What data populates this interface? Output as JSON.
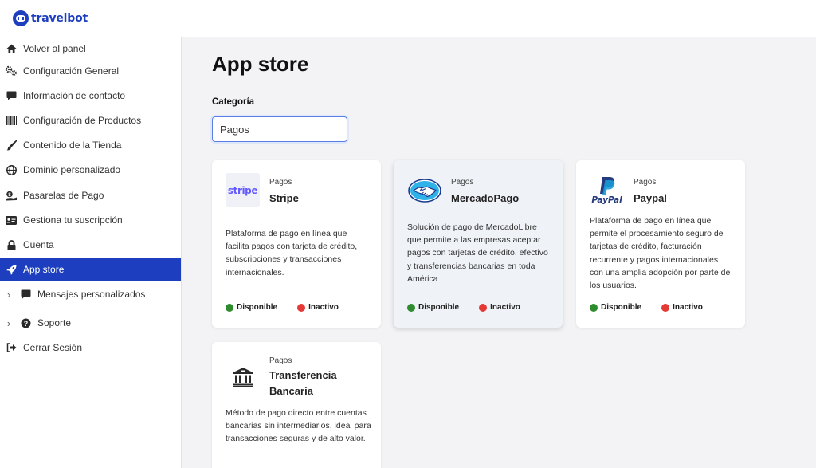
{
  "brand": {
    "name": "travelbot",
    "color": "#1d3fbf"
  },
  "sidebar": {
    "items": [
      {
        "label": "Volver al panel",
        "icon": "home-icon"
      },
      {
        "label": "Configuración General",
        "icon": "cogs-icon"
      },
      {
        "label": "Información de contacto",
        "icon": "comment-icon"
      },
      {
        "label": "Configuración de Productos",
        "icon": "barcode-icon"
      },
      {
        "label": "Contenido de la Tienda",
        "icon": "brush-icon"
      },
      {
        "label": "Dominio personalizado",
        "icon": "globe-icon"
      },
      {
        "label": "Pasarelas de Pago",
        "icon": "money-icon"
      },
      {
        "label": "Gestiona tu suscripción",
        "icon": "id-card-icon"
      },
      {
        "label": "Cuenta",
        "icon": "lock-icon"
      },
      {
        "label": "App store",
        "icon": "rocket-icon",
        "active": true
      },
      {
        "label": "Mensajes personalizados",
        "icon": "comment-icon",
        "collapsible": true
      },
      {
        "label": "Soporte",
        "icon": "question-circle-icon",
        "collapsible": true
      },
      {
        "label": "Cerrar Sesión",
        "icon": "sign-out-icon"
      }
    ]
  },
  "main": {
    "title": "App store",
    "category_label": "Categoría",
    "category_value": "Pagos"
  },
  "cards": [
    {
      "category": "Pagos",
      "name": "Stripe",
      "logo": "stripe-logo",
      "logo_text": "stripe",
      "description": "Plataforma de pago en línea que facilita pagos con tarjeta de crédito, subscripciones y transacciones internacionales.",
      "available_label": "Disponible",
      "inactive_label": "Inactivo"
    },
    {
      "category": "Pagos",
      "name": "MercadoPago",
      "logo": "mercadopago-handshake-logo",
      "description": "Solución de pago de MercadoLibre que permite a las empresas aceptar pagos con tarjetas de crédito, efectivo y transferencias bancarias en toda América",
      "available_label": "Disponible",
      "inactive_label": "Inactivo"
    },
    {
      "category": "Pagos",
      "name": "Paypal",
      "logo": "paypal-logo",
      "logo_text": "PayPal",
      "description": "Plataforma de pago en línea que permite el procesamiento seguro de tarjetas de crédito, facturación recurrente y pagos internacionales con una amplia adopción por parte de los usuarios.",
      "available_label": "Disponible",
      "inactive_label": "Inactivo"
    },
    {
      "category": "Pagos",
      "name": "Transferencia Bancaria",
      "logo": "bank-icon",
      "description": "Método de pago directo entre cuentas bancarias sin intermediarios, ideal para transacciones seguras y de alto valor."
    }
  ],
  "colors": {
    "active_nav": "#1d3fbf",
    "available_dot": "#2e8b2e",
    "inactive_dot": "#e53935"
  }
}
